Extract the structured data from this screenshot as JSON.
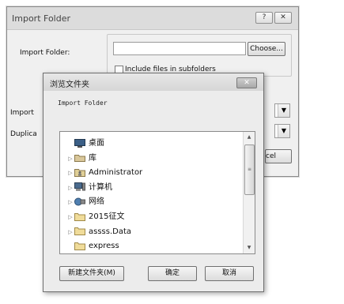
{
  "import_window": {
    "title": "Import Folder",
    "help_button": "?",
    "close_button": "✕",
    "import_folder_label": "Import Folder:",
    "import_folder_value": "",
    "choose_button": "Choose...",
    "include_subfolders_label": "Include files in subfolders",
    "import_label": "Import",
    "duplicate_label": "Duplica",
    "cancel_button": "cel"
  },
  "browse_dialog": {
    "title": "浏览文件夹",
    "close_button": "✕",
    "description": "Import Folder",
    "tree_items": [
      {
        "label": "桌面",
        "icon": "desktop-icon",
        "expander": ""
      },
      {
        "label": "库",
        "icon": "library-icon",
        "expander": "▷"
      },
      {
        "label": "Administrator",
        "icon": "user-folder-icon",
        "expander": "▷"
      },
      {
        "label": "计算机",
        "icon": "computer-icon",
        "expander": "▷"
      },
      {
        "label": "网络",
        "icon": "network-icon",
        "expander": "▷"
      },
      {
        "label": "2015征文",
        "icon": "folder-icon",
        "expander": "▷"
      },
      {
        "label": "assss.Data",
        "icon": "folder-icon",
        "expander": "▷"
      },
      {
        "label": "express",
        "icon": "folder-icon",
        "expander": ""
      }
    ],
    "new_folder_button": "新建文件夹(M)",
    "ok_button": "确定",
    "cancel_button": "取消"
  }
}
